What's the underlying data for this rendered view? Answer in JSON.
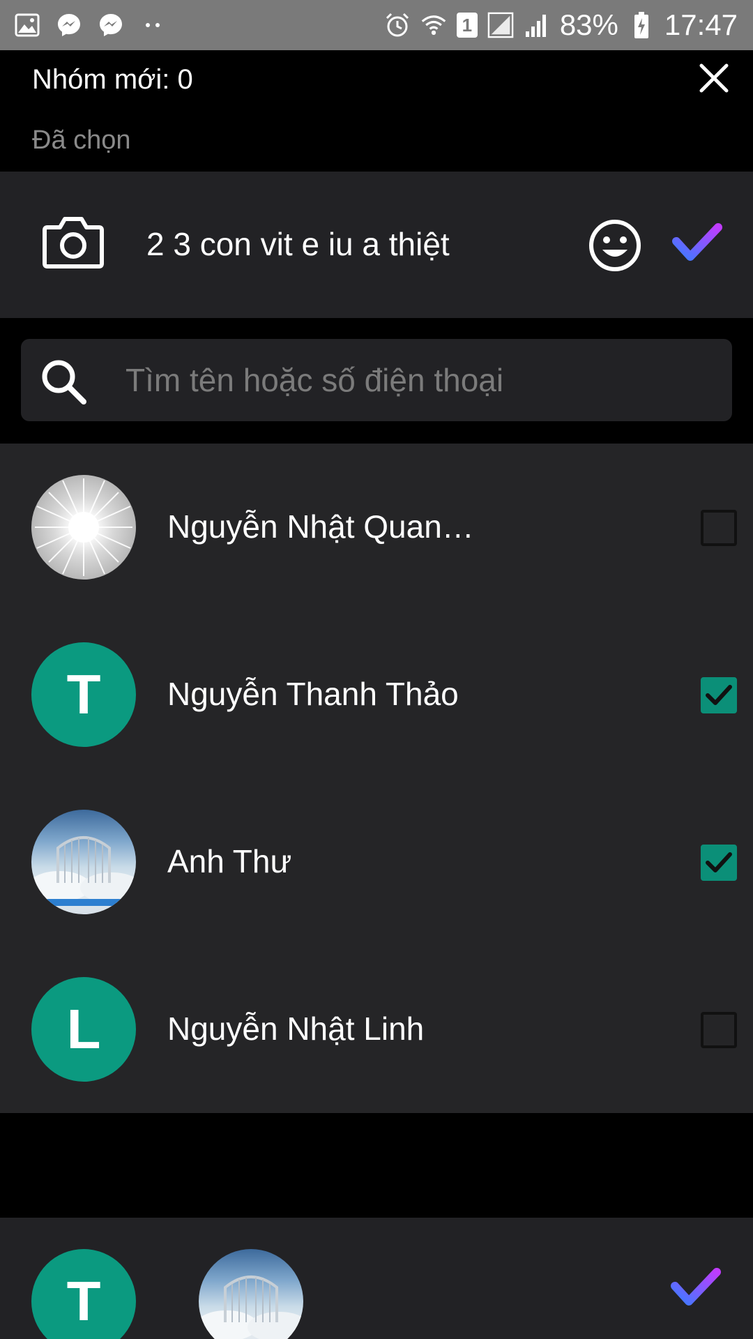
{
  "status_bar": {
    "battery": "83%",
    "time": "17:47",
    "sim": "1",
    "left_icons": [
      "gallery-icon",
      "messenger-icon",
      "messenger-icon",
      "more-dots-icon"
    ],
    "right_icons": [
      "alarm-icon",
      "wifi-icon",
      "sim-badge",
      "signal-icon",
      "signal-icon",
      "battery-icon"
    ]
  },
  "header": {
    "title": "Nhóm mới: 0",
    "selected_label": "Đã chọn"
  },
  "group_name": {
    "value": "2 3 con vit e iu a thiệt"
  },
  "search": {
    "placeholder": "Tìm tên hoặc số điện thoại"
  },
  "contacts": [
    {
      "name": "Nguyễn Nhật Quan…",
      "avatar": "sunburst-photo",
      "checked": false
    },
    {
      "name": "Nguyễn Thanh Thảo",
      "avatar_letter": "T",
      "checked": true
    },
    {
      "name": "Anh Thư",
      "avatar": "gate-photo",
      "checked": true
    },
    {
      "name": "Nguyễn Nhật Linh",
      "avatar_letter": "L",
      "checked": false
    }
  ],
  "selected_chips": [
    {
      "avatar_letter": "T"
    },
    {
      "avatar": "gate-photo"
    }
  ],
  "colors": {
    "accent_teal": "#0b9a80",
    "check_gradient_start": "#3b7cff",
    "check_gradient_end": "#c03cff",
    "panel": "#222225",
    "list_bg": "#252527"
  }
}
